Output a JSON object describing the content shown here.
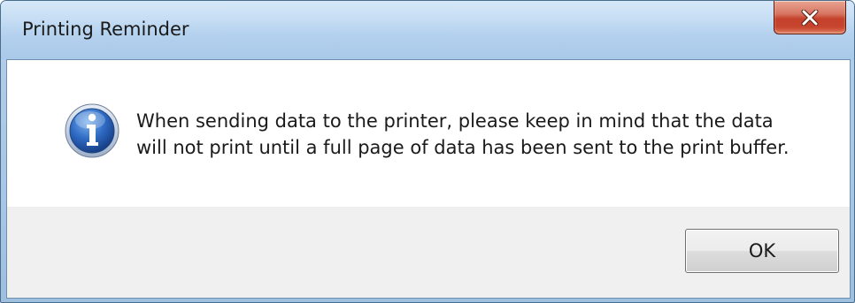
{
  "window": {
    "title": "Printing Reminder",
    "close_icon": "close-icon"
  },
  "dialog": {
    "icon": "information-icon",
    "message_lines": [
      "When sending data to the printer, please keep in mind that the data",
      "will not print until a full page of data has been sent to the print buffer."
    ]
  },
  "buttons": {
    "ok_label": "OK"
  },
  "colors": {
    "close_button": "#c7452e",
    "title_bar": "#b5d2ee",
    "info_icon": "#2a62b8"
  }
}
